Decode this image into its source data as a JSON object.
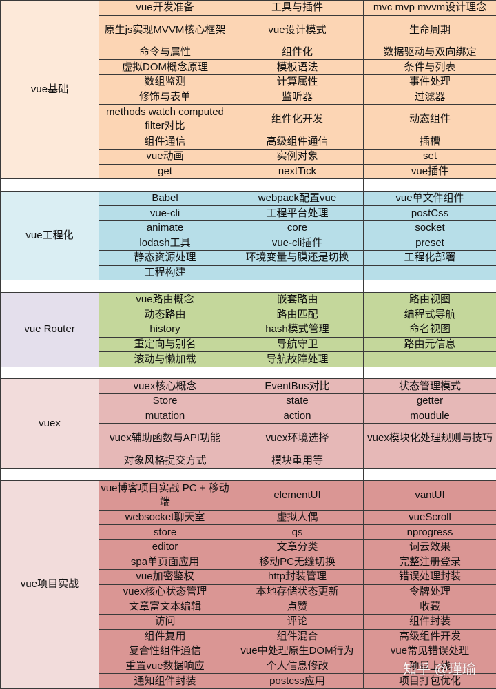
{
  "colors": {
    "vue_basics": {
      "label": "#fde9d9",
      "cell": "#fcd5b4"
    },
    "engineering": {
      "label": "#daeef3",
      "cell": "#b7dee8"
    },
    "router": {
      "label": "#e4dfec",
      "cell": "#c4d79b"
    },
    "vuex": {
      "label": "#f2dcdb",
      "cell": "#e6b8b7"
    },
    "project": {
      "label": "#f2dcdb",
      "cell": "#da9694"
    }
  },
  "sections": [
    {
      "key": "vue_basics",
      "label": "vue基础",
      "rows": [
        [
          "vue开发准备",
          "工具与插件",
          "mvc mvp mvvm设计理念"
        ],
        [
          "原生js实现MVVM核心框架",
          "vue设计模式",
          "生命周期"
        ],
        [
          "命令与属性",
          "组件化",
          "数据驱动与双向绑定"
        ],
        [
          "虚拟DOM概念原理",
          "模板语法",
          "条件与列表"
        ],
        [
          "数组监测",
          "计算属性",
          "事件处理"
        ],
        [
          "修饰与表单",
          "监听器",
          "过滤器"
        ],
        [
          "methods watch computed filter对比",
          "组件化开发",
          "动态组件"
        ],
        [
          "组件通信",
          "高级组件通信",
          "插槽"
        ],
        [
          "vue动画",
          "实例对象",
          "set"
        ],
        [
          "get",
          "nextTick",
          "vue插件"
        ]
      ],
      "double": [
        1,
        6
      ]
    },
    {
      "key": "engineering",
      "label": "vue工程化",
      "rows": [
        [
          "Babel",
          "webpack配置vue",
          "vue单文件组件"
        ],
        [
          "vue-cli",
          "工程平台处理",
          "postCss"
        ],
        [
          "animate",
          "core",
          "socket"
        ],
        [
          "lodash工具",
          "vue-cli插件",
          "preset"
        ],
        [
          "静态资源处理",
          "环境变量与膜还是切换",
          "工程化部署"
        ],
        [
          "工程构建",
          "",
          ""
        ]
      ],
      "double": []
    },
    {
      "key": "router",
      "label": "vue Router",
      "rows": [
        [
          "vue路由概念",
          "嵌套路由",
          "路由视图"
        ],
        [
          "动态路由",
          "路由匹配",
          "编程式导航"
        ],
        [
          "history",
          "hash模式管理",
          "命名视图"
        ],
        [
          "重定向与别名",
          "导航守卫",
          "路由元信息"
        ],
        [
          "滚动与懒加载",
          "导航故障处理",
          ""
        ]
      ],
      "double": []
    },
    {
      "key": "vuex",
      "label": "vuex",
      "rows": [
        [
          "vuex核心概念",
          "EventBus对比",
          "状态管理模式"
        ],
        [
          "Store",
          "state",
          "getter"
        ],
        [
          "mutation",
          "action",
          "moudule"
        ],
        [
          "vuex辅助函数与API功能",
          "vuex环境选择",
          "vuex模块化处理规则与技巧"
        ],
        [
          "对象风格提交方式",
          "模块重用等",
          ""
        ]
      ],
      "double": [
        3
      ]
    },
    {
      "key": "project",
      "label": "vue项目实战",
      "rows": [
        [
          "vue博客项目实战 PC + 移动端",
          "elementUI",
          "vantUI"
        ],
        [
          "websocket聊天室",
          "虚拟人偶",
          "vueScroll"
        ],
        [
          "store",
          "qs",
          "nprogress"
        ],
        [
          "editor",
          "文章分类",
          "词云效果"
        ],
        [
          "spa单页面应用",
          "移动PC无缝切换",
          "完整注册登录"
        ],
        [
          "vue加密鉴权",
          "http封装管理",
          "错误处理封装"
        ],
        [
          "vuex核心状态管理",
          "本地存储状态更新",
          "令牌处理"
        ],
        [
          "文章富文本编辑",
          "点赞",
          "收藏"
        ],
        [
          "访问",
          "评论",
          "组件封装"
        ],
        [
          "组件复用",
          "组件混合",
          "高级组件开发"
        ],
        [
          "复合性组件通信",
          "vue中处理原生DOM行为",
          "vue常见错误处理"
        ],
        [
          "重置vue数据响应",
          "个人信息修改",
          "项目上线"
        ],
        [
          "通知组件封装",
          "postcss应用",
          "项目打包优化"
        ]
      ],
      "double": [
        0
      ]
    }
  ],
  "watermark": "知乎 @瑾瑜"
}
